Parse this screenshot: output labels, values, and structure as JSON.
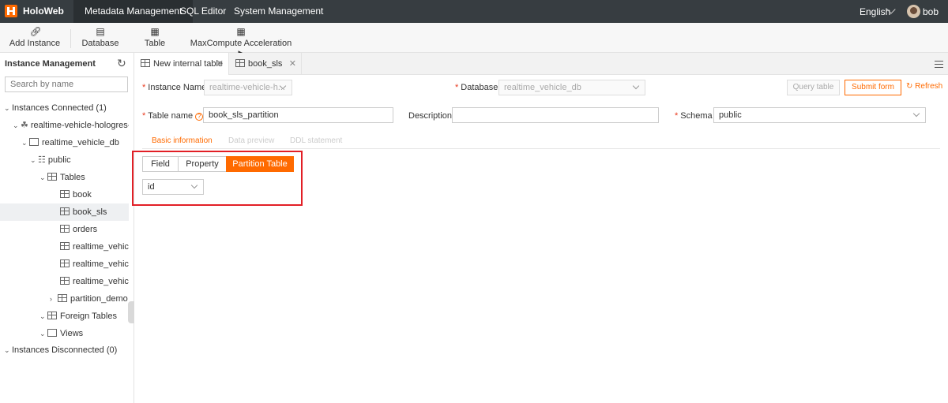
{
  "app": {
    "brand": "HoloWeb"
  },
  "nav": {
    "items": [
      "Metadata Management",
      "SQL Editor",
      "System Management"
    ],
    "active": "Metadata Management"
  },
  "header": {
    "language": "English",
    "user": "bob"
  },
  "toolbar": {
    "add_instance": "Add Instance",
    "database": "Database",
    "table": "Table",
    "maxcompute": "MaxCompute Acceleration"
  },
  "sidebar": {
    "title": "Instance Management",
    "search_placeholder": "Search by name",
    "tree": [
      {
        "label": "Instances Connected (1)"
      },
      {
        "label": "realtime-vehicle-hologres-lin"
      },
      {
        "label": "realtime_vehicle_db"
      },
      {
        "label": "public"
      },
      {
        "label": "Tables"
      },
      {
        "label": "book"
      },
      {
        "label": "book_sls"
      },
      {
        "label": "orders"
      },
      {
        "label": "realtime_vehicle_t"
      },
      {
        "label": "realtime_vehicle_t"
      },
      {
        "label": "realtime_vehicle_t"
      },
      {
        "label": "partition_demo"
      },
      {
        "label": "Foreign Tables"
      },
      {
        "label": "Views"
      },
      {
        "label": "Instances Disconnected (0)"
      }
    ]
  },
  "tabs": [
    {
      "label": "New internal table"
    },
    {
      "label": "book_sls"
    }
  ],
  "form": {
    "instance_label": "Instance Name",
    "instance_value": "realtime-vehicle-h...",
    "database_label": "Database",
    "database_value": "realtime_vehicle_db",
    "query_table": "Query table",
    "submit_form": "Submit form",
    "refresh": "Refresh",
    "table_name_label": "Table name",
    "table_name_value": "book_sls_partition",
    "description_label": "Description",
    "description_value": "",
    "schema_label": "Schema",
    "schema_value": "public"
  },
  "subtabs": {
    "basic": "Basic information",
    "preview": "Data preview",
    "ddl": "DDL statement"
  },
  "segments": {
    "field": "Field",
    "property": "Property",
    "partition": "Partition Table"
  },
  "partition_column": "id",
  "colors": {
    "accent": "#ff6a00",
    "topbar": "#373d41",
    "highlight": "#e21f26"
  }
}
